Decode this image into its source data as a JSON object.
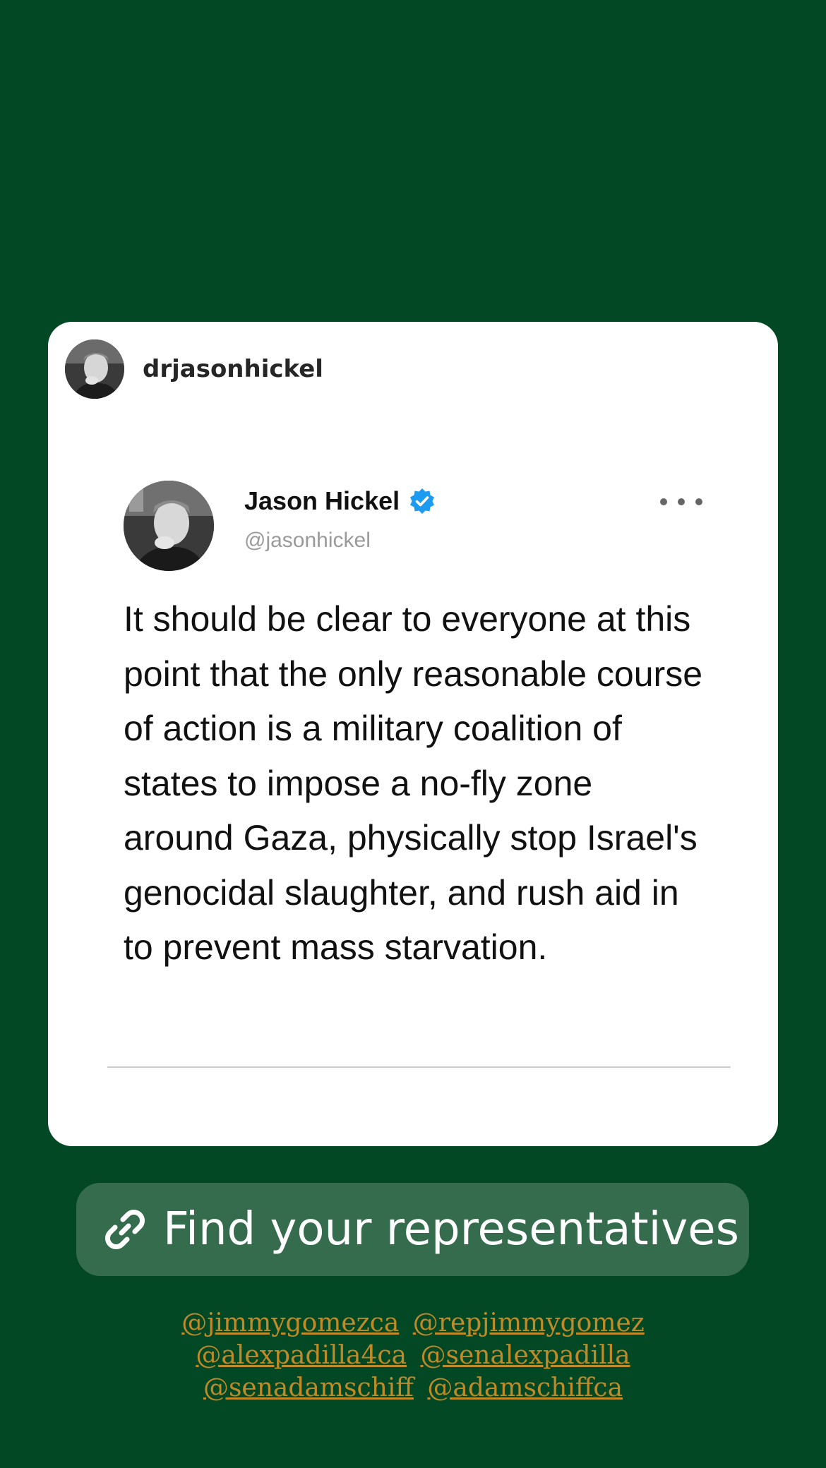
{
  "post": {
    "owner_username": "drjasonhickel"
  },
  "tweet": {
    "author_name": "Jason Hickel",
    "handle": "@jasonhickel",
    "verified_icon": "verified-badge-icon",
    "more_icon": "more-horizontal-icon",
    "text": "It should be clear to everyone at this point that the only reasonable course of action is a military coalition of states to impose a no-fly zone around Gaza, physically stop Israel's genocidal slaughter, and rush aid in to prevent mass starvation."
  },
  "link_sticker": {
    "icon": "link-icon",
    "label": "Find your representatives"
  },
  "mentions": [
    [
      "@jimmygomezca",
      "@repjimmygomez"
    ],
    [
      "@alexpadilla4ca",
      "@senalexpadilla"
    ],
    [
      "@senadamschiff",
      "@adamschiffca"
    ]
  ],
  "colors": {
    "background": "#034825",
    "card": "#ffffff",
    "link_sticker": "#356c4d",
    "mention_text": "#c08a27",
    "verified": "#1d9bf0"
  }
}
